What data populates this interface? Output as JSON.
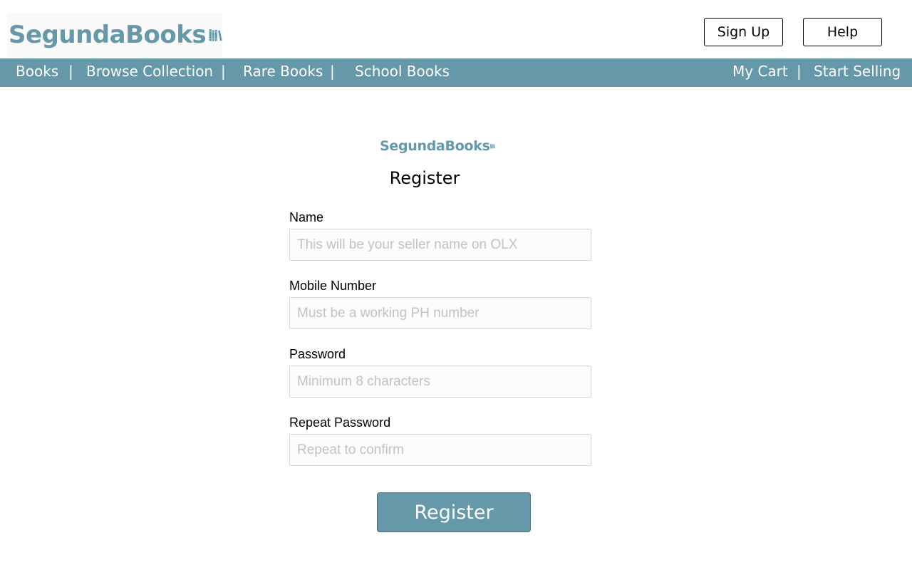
{
  "brand": {
    "name": "SegundaBooks",
    "color": "#6598a8",
    "icon": "books-stack-icon"
  },
  "header": {
    "signup_label": "Sign Up",
    "help_label": "Help"
  },
  "nav": {
    "left_items": [
      "Books",
      "Browse Collection",
      "Rare Books",
      "School Books"
    ],
    "right_items": [
      "My Cart",
      "Start Selling"
    ],
    "separator": "|"
  },
  "form": {
    "title": "Register",
    "fields": [
      {
        "label": "Name",
        "placeholder": "This will be your seller name on OLX",
        "value": ""
      },
      {
        "label": "Mobile Number",
        "placeholder": "Must be a working PH number",
        "value": ""
      },
      {
        "label": "Password",
        "placeholder": "Minimum 8 characters",
        "value": ""
      },
      {
        "label": "Repeat Password",
        "placeholder": "Repeat to confirm",
        "value": ""
      }
    ],
    "submit_label": "Register"
  }
}
